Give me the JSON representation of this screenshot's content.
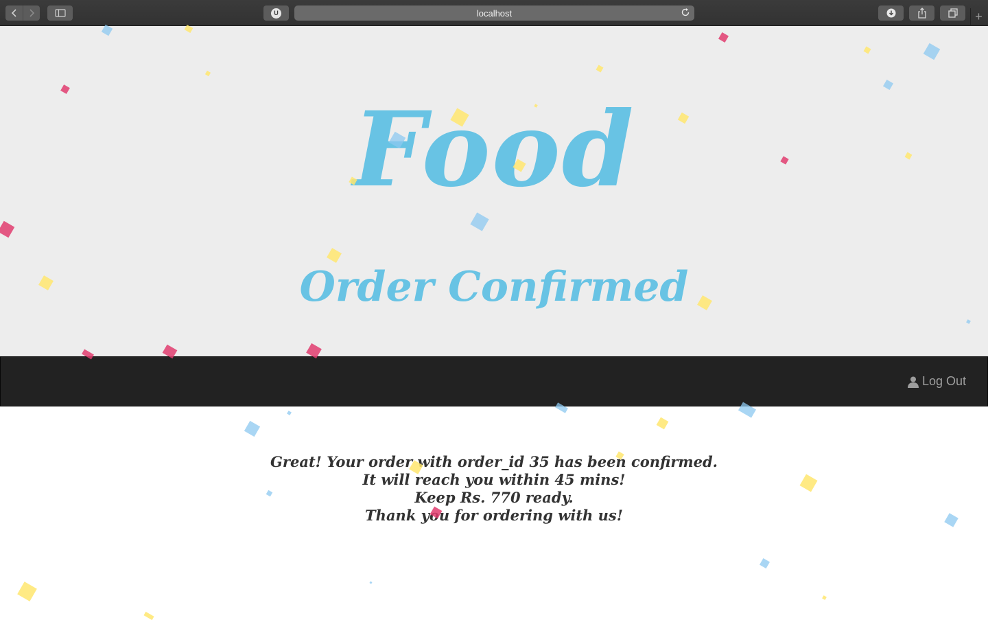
{
  "browser": {
    "url": "localhost",
    "extension_badge": "U",
    "new_tab_symbol": "+"
  },
  "hero": {
    "brand": "Food",
    "subtitle": "Order Confirmed"
  },
  "navbar": {
    "logout_label": "Log Out"
  },
  "message": {
    "lines": [
      "Great! Your order with order_id 35 has been confirmed.",
      "It will reach you within 45 mins!",
      "Keep Rs. 770 ready.",
      "Thank you for ordering with us!"
    ]
  },
  "colors": {
    "accent": "#68c3e4",
    "navbar": "#222222",
    "hero_bg": "#ededed",
    "confetti": [
      "#8cc8f0",
      "#ffe66e",
      "#e03c6e"
    ]
  },
  "icons": {
    "back": "chevron-left-icon",
    "forward": "chevron-right-icon",
    "sidebar": "sidebar-icon",
    "reload": "reload-icon",
    "download": "download-icon",
    "share": "share-icon",
    "tabs": "tabs-icon",
    "user": "user-icon"
  }
}
